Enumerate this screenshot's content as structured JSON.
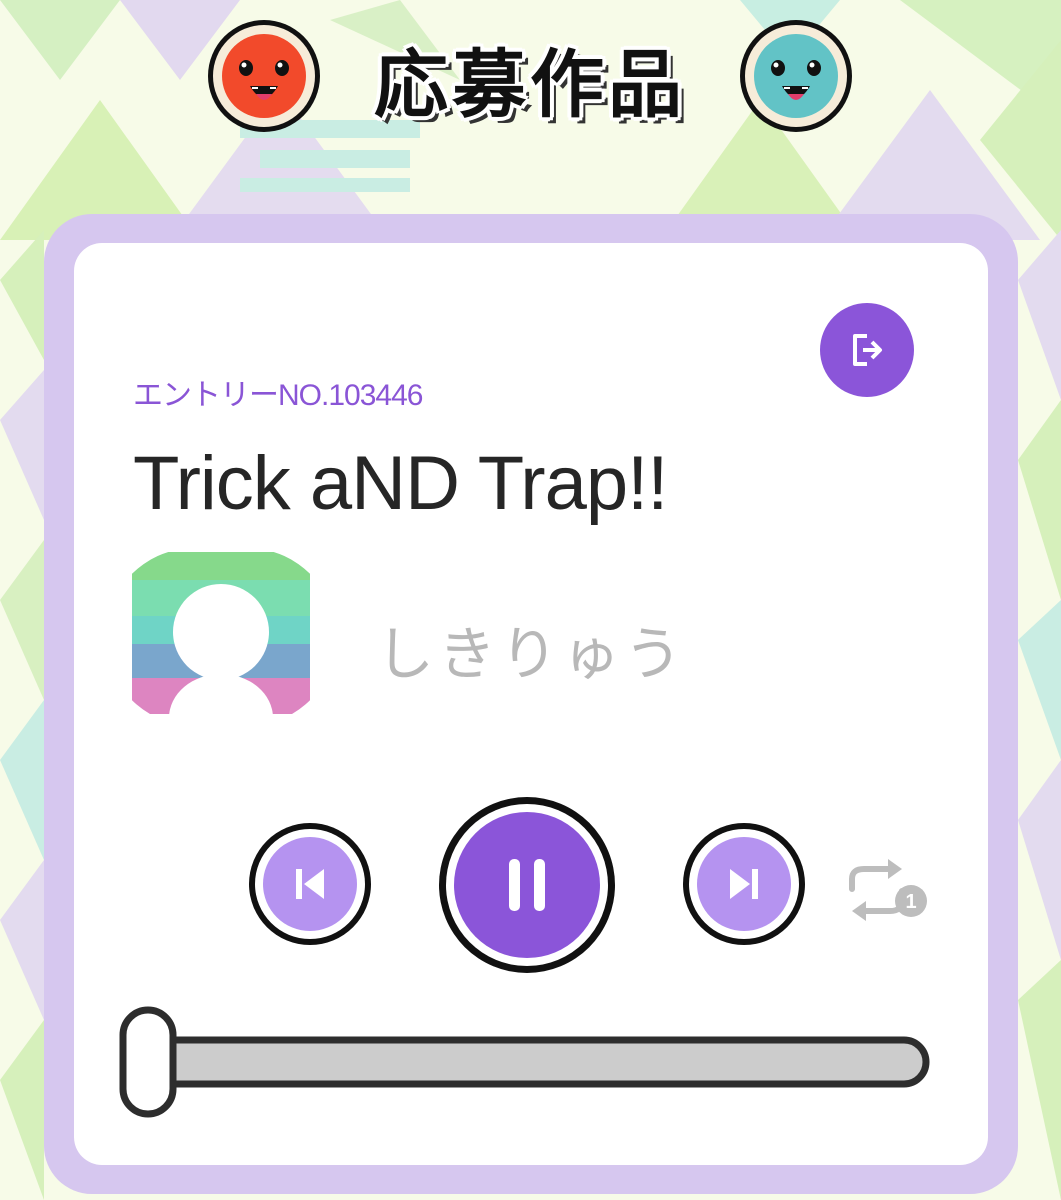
{
  "header": {
    "title": "応募作品",
    "left_mascot": "don-red-face",
    "right_mascot": "katsu-blue-face"
  },
  "entry": {
    "number_label": "エントリーNO.103446",
    "title": "Trick aND Trap!!",
    "artist": "しきりゅう",
    "avatar_icon": "default-user-avatar"
  },
  "actions": {
    "exit_icon": "exit-icon"
  },
  "player": {
    "prev_icon": "skip-previous-icon",
    "play_state_icon": "pause-icon",
    "next_icon": "skip-next-icon",
    "repeat_icon": "repeat-one-icon",
    "repeat_badge": "1",
    "progress_fraction": 0.0
  },
  "colors": {
    "accent": "#8b55d9",
    "accent_light": "#b593f0",
    "card_border": "#d6c7ef",
    "text_dark": "#262626",
    "text_muted": "#b8b8b8"
  }
}
